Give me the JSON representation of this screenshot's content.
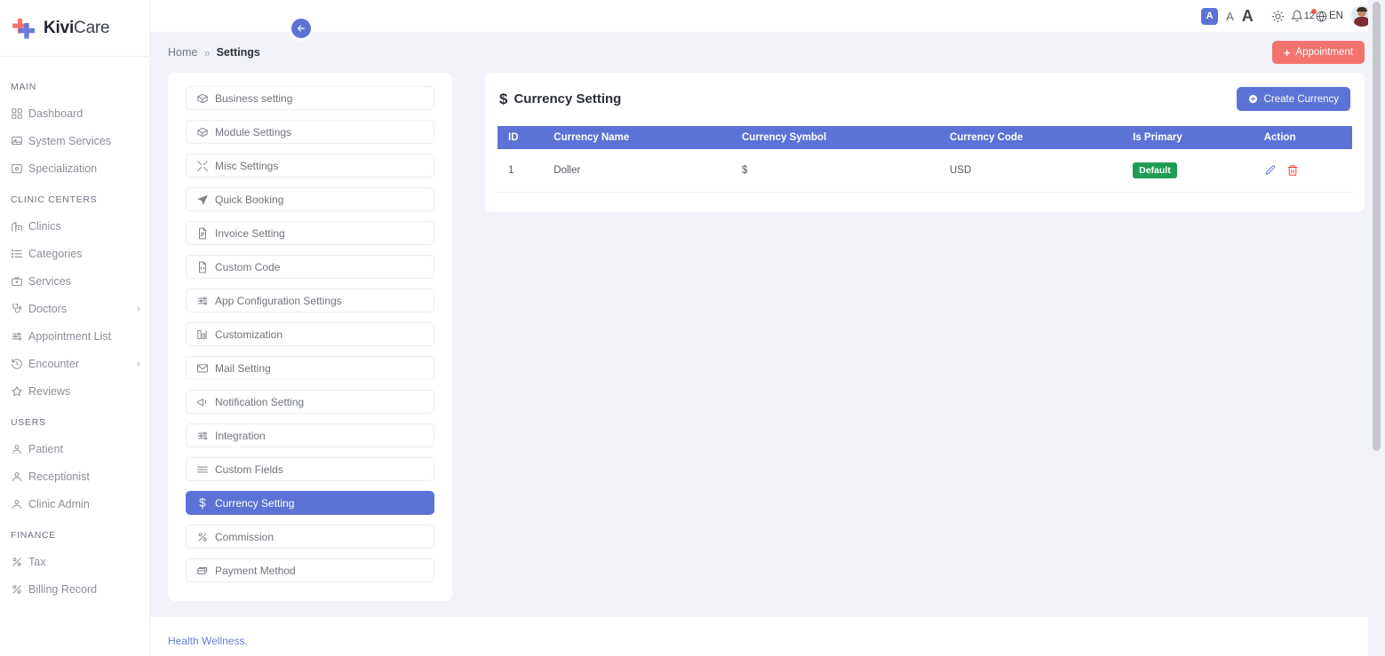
{
  "brand": {
    "bold": "Kivi",
    "light": "Care",
    "logo_icon": "medical-cross-logo"
  },
  "sidebar": {
    "sections": [
      {
        "title": "MAIN",
        "items": [
          {
            "label": "Dashboard",
            "icon": "grid-icon",
            "chevron": ""
          },
          {
            "label": "System Services",
            "icon": "monitor-icon",
            "chevron": ""
          },
          {
            "label": "Specialization",
            "icon": "badge-icon",
            "chevron": ""
          }
        ]
      },
      {
        "title": "CLINIC CENTERS",
        "items": [
          {
            "label": "Clinics",
            "icon": "building-icon",
            "chevron": ""
          },
          {
            "label": "Categories",
            "icon": "list-icon",
            "chevron": ""
          },
          {
            "label": "Services",
            "icon": "briefcase-icon",
            "chevron": ""
          },
          {
            "label": "Doctors",
            "icon": "stethoscope-icon",
            "chevron": "›"
          },
          {
            "label": "Appointment List",
            "icon": "sliders-icon",
            "chevron": ""
          },
          {
            "label": "Encounter",
            "icon": "history-icon",
            "chevron": "›"
          },
          {
            "label": "Reviews",
            "icon": "star-icon",
            "chevron": ""
          }
        ]
      },
      {
        "title": "USERS",
        "items": [
          {
            "label": "Patient",
            "icon": "user-icon",
            "chevron": ""
          },
          {
            "label": "Receptionist",
            "icon": "user-icon",
            "chevron": ""
          },
          {
            "label": "Clinic Admin",
            "icon": "user-icon",
            "chevron": ""
          }
        ]
      },
      {
        "title": "FINANCE",
        "items": [
          {
            "label": "Tax",
            "icon": "percent-icon",
            "chevron": ""
          },
          {
            "label": "Billing Record",
            "icon": "percent-icon",
            "chevron": ""
          }
        ]
      }
    ]
  },
  "topbar": {
    "font_small": "A",
    "font_medium": "A",
    "font_large": "A",
    "theme_icon": "sun-icon",
    "notification_icon": "bell-icon",
    "notification_count": "12",
    "language_icon": "globe-icon",
    "language": "EN",
    "avatar_icon": "user-avatar",
    "collapse_icon": "arrow-left-icon"
  },
  "breadcrumb": {
    "home": "Home",
    "separator": "»",
    "current": "Settings"
  },
  "appointment_button": {
    "plus": "+",
    "label": "Appointment"
  },
  "settings_menu": {
    "items": [
      {
        "label": "Business setting",
        "icon": "box-icon",
        "active": false
      },
      {
        "label": "Module Settings",
        "icon": "box-icon",
        "active": false
      },
      {
        "label": "Misc Settings",
        "icon": "tools-icon",
        "active": false
      },
      {
        "label": "Quick Booking",
        "icon": "send-icon",
        "active": false
      },
      {
        "label": "Invoice Setting",
        "icon": "invoice-icon",
        "active": false
      },
      {
        "label": "Custom Code",
        "icon": "code-file-icon",
        "active": false
      },
      {
        "label": "App Configuration Settings",
        "icon": "sliders-icon",
        "active": false
      },
      {
        "label": "Customization",
        "icon": "customize-icon",
        "active": false
      },
      {
        "label": "Mail Setting",
        "icon": "mail-icon",
        "active": false
      },
      {
        "label": "Notification Setting",
        "icon": "megaphone-icon",
        "active": false
      },
      {
        "label": "Integration",
        "icon": "sliders-icon",
        "active": false
      },
      {
        "label": "Custom Fields",
        "icon": "menu-lines-icon",
        "active": false
      },
      {
        "label": "Currency Setting",
        "icon": "dollar-icon",
        "active": true
      },
      {
        "label": "Commission",
        "icon": "percent-icon",
        "active": false
      },
      {
        "label": "Payment Method",
        "icon": "cards-icon",
        "active": false
      }
    ]
  },
  "currency_panel": {
    "title": "Currency Setting",
    "title_icon": "dollar-icon",
    "create_button": {
      "icon": "plus-circle-icon",
      "label": "Create Currency"
    },
    "table": {
      "columns": [
        "ID",
        "Currency Name",
        "Currency Symbol",
        "Currency Code",
        "Is Primary",
        "Action"
      ],
      "rows": [
        {
          "id": "1",
          "currency_name": "Doller",
          "currency_symbol": "$",
          "currency_code": "USD",
          "is_primary": "Default",
          "actions": {
            "edit_icon": "pencil-icon",
            "delete_icon": "trash-icon"
          }
        }
      ]
    }
  },
  "footer": {
    "text": "Health Wellness."
  },
  "colors": {
    "primary": "#5c72d6",
    "accent": "#f4736d",
    "success": "#1f9d55",
    "danger": "#e8443a",
    "background": "#f1f3f9"
  }
}
